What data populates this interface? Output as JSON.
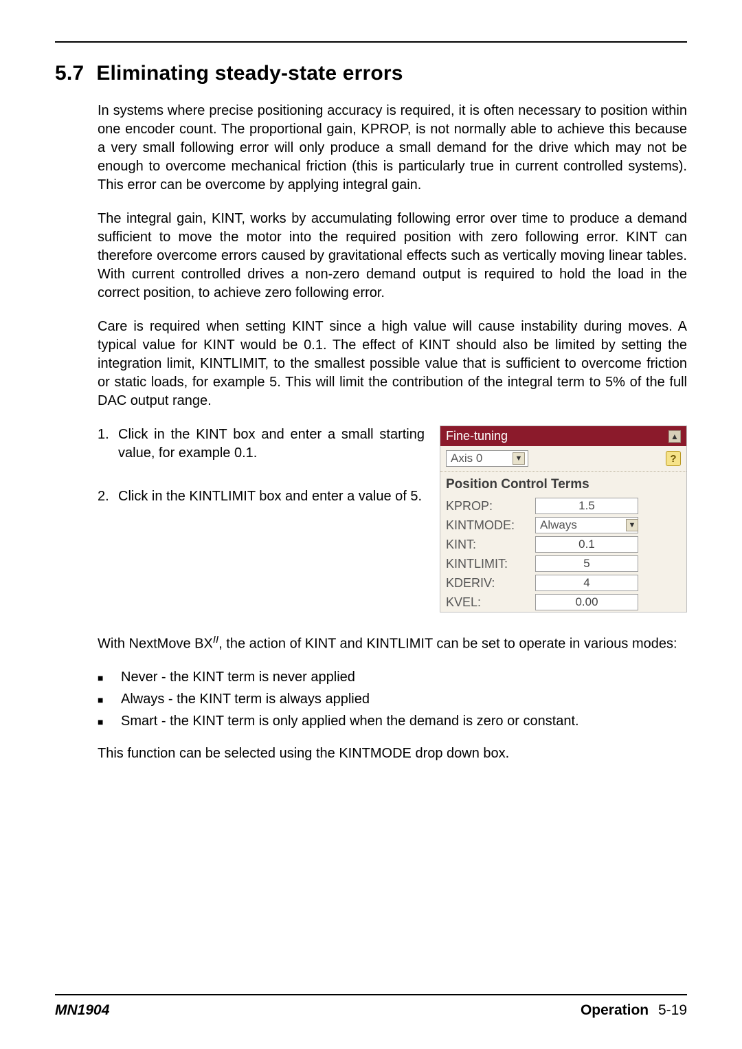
{
  "section": {
    "number": "5.7",
    "title": "Eliminating steady-state errors"
  },
  "paragraphs": {
    "p1": "In systems where precise positioning accuracy is required, it is often necessary to position within one encoder count. The proportional gain, KPROP, is not normally able to achieve this because a very small following error will only produce a small demand for the drive which may not be enough to overcome mechanical friction (this is particularly true in current controlled systems). This error can be overcome by applying integral gain.",
    "p2": "The integral gain, KINT, works by accumulating following error over time to produce a demand sufficient to move the motor into the required position with zero following error. KINT can therefore overcome errors caused by gravitational effects such as vertically moving linear tables. With current controlled drives a non-zero demand output is required to hold the load in the correct position, to achieve zero following error.",
    "p3": "Care is required when setting KINT since a high value will cause instability during moves. A typical value for KINT would be 0.1. The effect of KINT should also be limited by setting the integration limit, KINTLIMIT, to the smallest possible value that is sufficient to overcome friction or static loads, for example 5. This will limit the contribution of the integral term to 5% of the full DAC output range."
  },
  "steps": [
    {
      "num": "1.",
      "text": "Click in the KINT box and enter a small starting value, for example 0.1."
    },
    {
      "num": "2.",
      "text": "Click in the KINTLIMIT box and enter a value of 5."
    }
  ],
  "panel": {
    "title": "Fine-tuning",
    "axis": "Axis 0",
    "subhead": "Position Control Terms",
    "rows": [
      {
        "label": "KPROP:",
        "value": "1.5",
        "type": "input"
      },
      {
        "label": "KINTMODE:",
        "value": "Always",
        "type": "select"
      },
      {
        "label": "KINT:",
        "value": "0.1",
        "type": "input"
      },
      {
        "label": "KINTLIMIT:",
        "value": "5",
        "type": "input"
      },
      {
        "label": "KDERIV:",
        "value": "4",
        "type": "input"
      },
      {
        "label": "KVEL:",
        "value": "0.00",
        "type": "input"
      }
    ]
  },
  "after": {
    "intro_prefix": "With NextMove BX",
    "intro_sup": "II",
    "intro_suffix": ", the action of KINT and KINTLIMIT can be set to operate in various modes:",
    "bullets": [
      "Never - the KINT term is never applied",
      "Always - the KINT term is always applied",
      "Smart - the KINT term is only applied when the demand is zero or constant."
    ],
    "closing": "This function can be selected using the KINTMODE drop down box."
  },
  "footer": {
    "doc": "MN1904",
    "section": "Operation",
    "page": "5-19"
  }
}
